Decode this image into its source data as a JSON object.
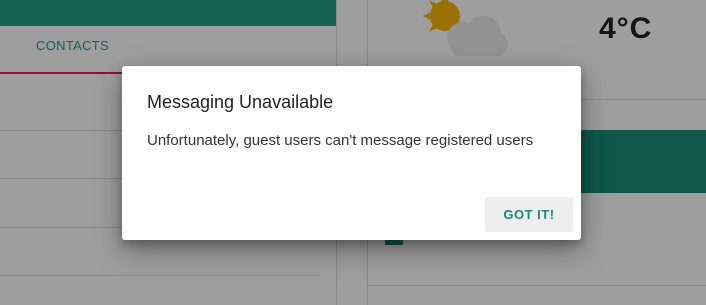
{
  "contacts_tab": {
    "label": "CONTACTS"
  },
  "weather": {
    "icon": "partly-cloudy-icon",
    "temperature": "4°C"
  },
  "dialog": {
    "title": "Messaging Unavailable",
    "message": "Unfortunately, guest users can't message registered users",
    "button_label": "GOT IT!"
  },
  "colors": {
    "accent": "#26a18b",
    "accent_dark": "#1a8b78",
    "tab_indicator": "#e91e63",
    "sun": "#f5b800",
    "cloud": "#eeeeee"
  }
}
